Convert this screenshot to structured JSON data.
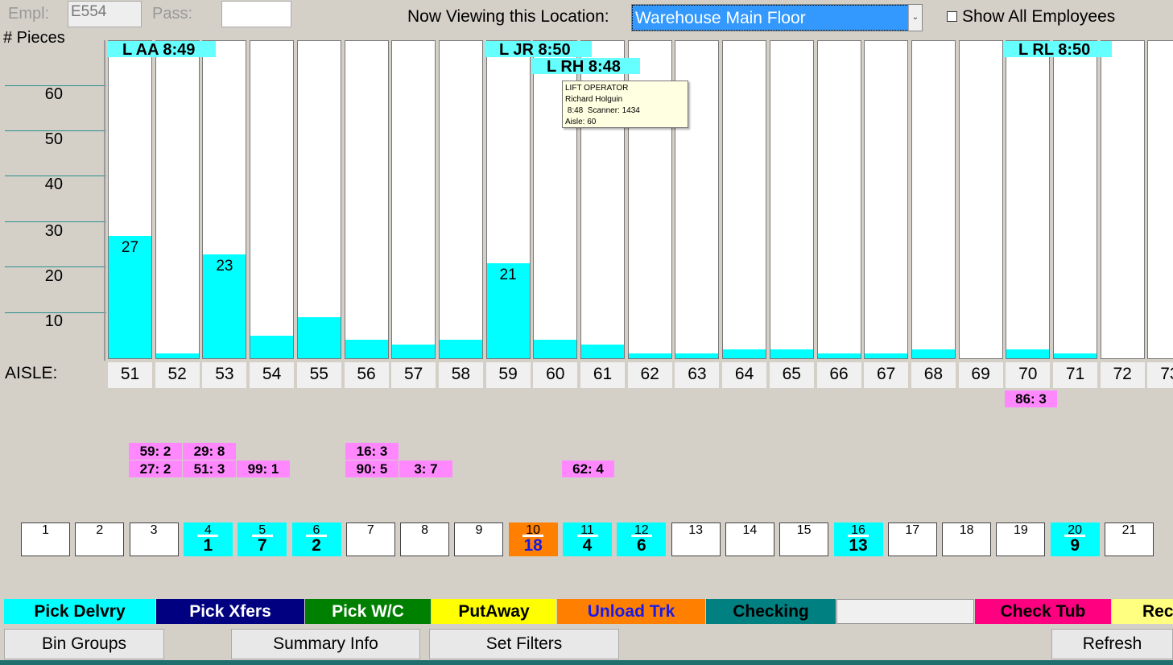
{
  "header": {
    "empl_label": "Empl:",
    "empl_value": "E554",
    "pass_label": "Pass:",
    "pass_value": "",
    "location_label": "Now Viewing this Location:",
    "location_value": "Warehouse Main Floor",
    "show_all_label": "Show All Employees",
    "show_all_checked": false
  },
  "chart": {
    "y_axis_label": "# Pieces",
    "y_ticks": [
      "60",
      "50",
      "40",
      "30",
      "20",
      "10"
    ],
    "aisle_label": "AISLE:"
  },
  "chart_data": {
    "type": "bar",
    "categories": [
      "51",
      "52",
      "53",
      "54",
      "55",
      "56",
      "57",
      "58",
      "59",
      "60",
      "61",
      "62",
      "63",
      "64",
      "65",
      "66",
      "67",
      "68",
      "69",
      "70",
      "71",
      "72",
      "73"
    ],
    "values": [
      27,
      1,
      23,
      5,
      9,
      4,
      3,
      4,
      21,
      4,
      3,
      1,
      1,
      2,
      2,
      1,
      1,
      2,
      0,
      2,
      1,
      0,
      0
    ],
    "data_labels": [
      "27",
      "",
      "23",
      "",
      "",
      "",
      "",
      "",
      "21",
      "",
      "",
      "",
      "",
      "",
      "",
      "",
      "",
      "",
      "",
      "",
      "",
      "",
      ""
    ],
    "ylim": [
      0,
      70
    ],
    "bar_color": "#00ffff"
  },
  "employees": [
    {
      "label": "L AA 8:49"
    },
    {
      "label": "L JR 8:50"
    },
    {
      "label": "L RH 8:48"
    },
    {
      "label": "L RL 8:50"
    }
  ],
  "tooltip": {
    "line1": "LIFT OPERATOR",
    "line2": "Richard Holguin",
    "line3": " 8:48  Scanner: 1434",
    "line4": "Aisle: 60"
  },
  "tags": [
    "86: 3",
    "59: 2",
    "29: 8",
    "27: 2",
    "51: 3",
    "99: 1",
    "16: 3",
    "90: 5",
    "3: 7",
    "62: 4"
  ],
  "bins": [
    {
      "num": "1",
      "count": ""
    },
    {
      "num": "2",
      "count": ""
    },
    {
      "num": "3",
      "count": ""
    },
    {
      "num": "4",
      "count": "1"
    },
    {
      "num": "5",
      "count": "7"
    },
    {
      "num": "6",
      "count": "2"
    },
    {
      "num": "7",
      "count": ""
    },
    {
      "num": "8",
      "count": ""
    },
    {
      "num": "9",
      "count": ""
    },
    {
      "num": "10",
      "count": "18"
    },
    {
      "num": "11",
      "count": "4"
    },
    {
      "num": "12",
      "count": "6"
    },
    {
      "num": "13",
      "count": ""
    },
    {
      "num": "14",
      "count": ""
    },
    {
      "num": "15",
      "count": ""
    },
    {
      "num": "16",
      "count": "13"
    },
    {
      "num": "17",
      "count": ""
    },
    {
      "num": "18",
      "count": ""
    },
    {
      "num": "19",
      "count": ""
    },
    {
      "num": "20",
      "count": "9"
    },
    {
      "num": "21",
      "count": ""
    }
  ],
  "legend": [
    {
      "label": "Pick Delvry",
      "bg": "#00ffff",
      "fg": "#000000"
    },
    {
      "label": "Pick Xfers",
      "bg": "#000080",
      "fg": "#ffffff"
    },
    {
      "label": "Pick W/C",
      "bg": "#008000",
      "fg": "#ffffff"
    },
    {
      "label": "PutAway",
      "bg": "#ffff00",
      "fg": "#000000"
    },
    {
      "label": "Unload Trk",
      "bg": "#ff8000",
      "fg": "#1a1ae6"
    },
    {
      "label": "Checking",
      "bg": "#008080",
      "fg": "#000000"
    },
    {
      "label": "",
      "bg": "#f0f0f0",
      "fg": "#000000"
    },
    {
      "label": "Check Tub",
      "bg": "#ff0080",
      "fg": "#000000"
    },
    {
      "label": "Rec",
      "bg": "#ffff80",
      "fg": "#000000"
    }
  ],
  "buttons": {
    "bin_groups": "Bin Groups",
    "summary_info": "Summary Info",
    "set_filters": "Set Filters",
    "refresh": "Refresh"
  }
}
